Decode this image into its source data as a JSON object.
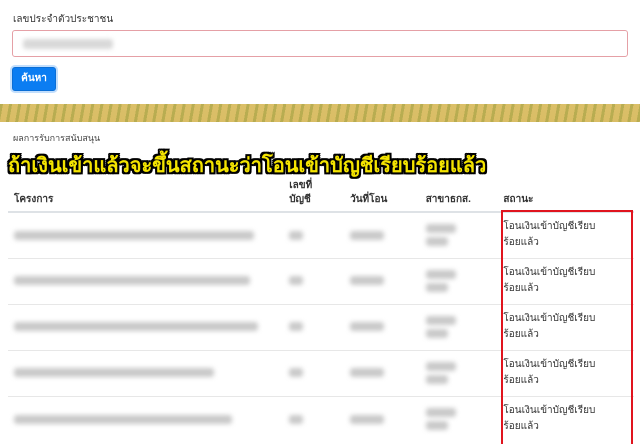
{
  "search": {
    "label": "เลขประจำตัวประชาชน",
    "button_label": "ค้นหา"
  },
  "results": {
    "title": "ผลการรับการสนับสนุน",
    "caption": "ถ้าเงินเข้าแล้วจะขึ้นสถานะว่าโอนเข้าบัญชีเรียบร้อยแล้ว",
    "columns": {
      "project": "โครงการ",
      "account": "เลขที่ บัญชี",
      "date": "วันที่โอน",
      "branch": "สาขาธกส.",
      "status": "สถานะ"
    },
    "rows": [
      {
        "status_line1": "โอนเงินเข้าบัญชีเรียบ",
        "status_line2": "ร้อยแล้ว"
      },
      {
        "status_line1": "โอนเงินเข้าบัญชีเรียบ",
        "status_line2": "ร้อยแล้ว"
      },
      {
        "status_line1": "โอนเงินเข้าบัญชีเรียบ",
        "status_line2": "ร้อยแล้ว"
      },
      {
        "status_line1": "โอนเงินเข้าบัญชีเรียบ",
        "status_line2": "ร้อยแล้ว"
      },
      {
        "status_line1": "โอนเงินเข้าบัญชีเรียบ",
        "status_line2": "ร้อยแล้ว"
      }
    ]
  },
  "colors": {
    "button": "#0b7df2",
    "caption": "#f4e400",
    "highlight": "#e0141e"
  }
}
